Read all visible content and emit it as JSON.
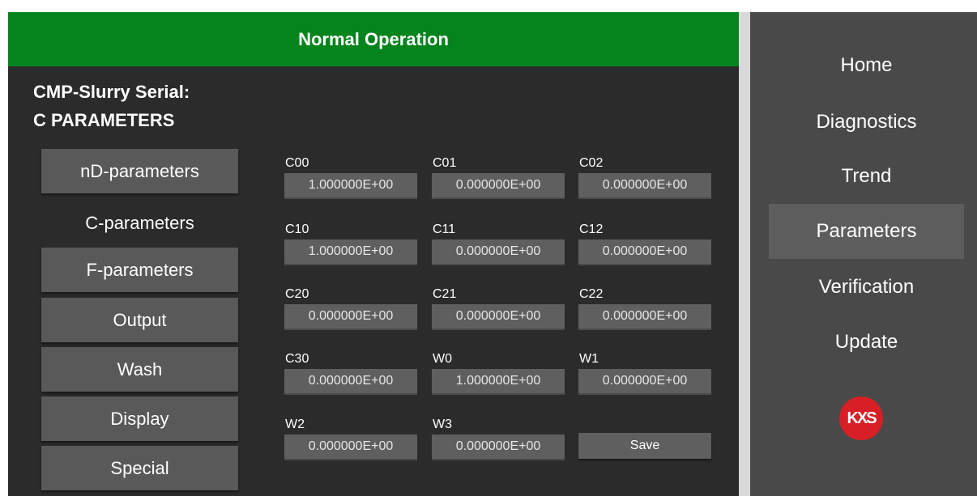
{
  "status": {
    "text": "Normal Operation",
    "color": "#05841d"
  },
  "device": {
    "serial_label": "CMP-Slurry Serial:",
    "section_title": "C PARAMETERS"
  },
  "categories": {
    "nd": "nD-parameters",
    "c": "C-parameters",
    "f": "F-parameters",
    "output": "Output",
    "wash": "Wash",
    "display": "Display",
    "special": "Special",
    "active": "C-parameters"
  },
  "params": {
    "c00": {
      "label": "C00",
      "value": "1.000000E+00"
    },
    "c01": {
      "label": "C01",
      "value": "0.000000E+00"
    },
    "c02": {
      "label": "C02",
      "value": "0.000000E+00"
    },
    "c10": {
      "label": "C10",
      "value": "1.000000E+00"
    },
    "c11": {
      "label": "C11",
      "value": "0.000000E+00"
    },
    "c12": {
      "label": "C12",
      "value": "0.000000E+00"
    },
    "c20": {
      "label": "C20",
      "value": "0.000000E+00"
    },
    "c21": {
      "label": "C21",
      "value": "0.000000E+00"
    },
    "c22": {
      "label": "C22",
      "value": "0.000000E+00"
    },
    "c30": {
      "label": "C30",
      "value": "0.000000E+00"
    },
    "w0": {
      "label": "W0",
      "value": "1.000000E+00"
    },
    "w1": {
      "label": "W1",
      "value": "0.000000E+00"
    },
    "w2": {
      "label": "W2",
      "value": "0.000000E+00"
    },
    "w3": {
      "label": "W3",
      "value": "0.000000E+00"
    }
  },
  "save_label": "Save",
  "nav": {
    "home": "Home",
    "diagnostics": "Diagnostics",
    "trend": "Trend",
    "parameters": "Parameters",
    "verification": "Verification",
    "update": "Update",
    "active": "Parameters"
  },
  "logo": {
    "text": "KXS",
    "icon": "kxs-logo",
    "color": "#d81f26"
  }
}
